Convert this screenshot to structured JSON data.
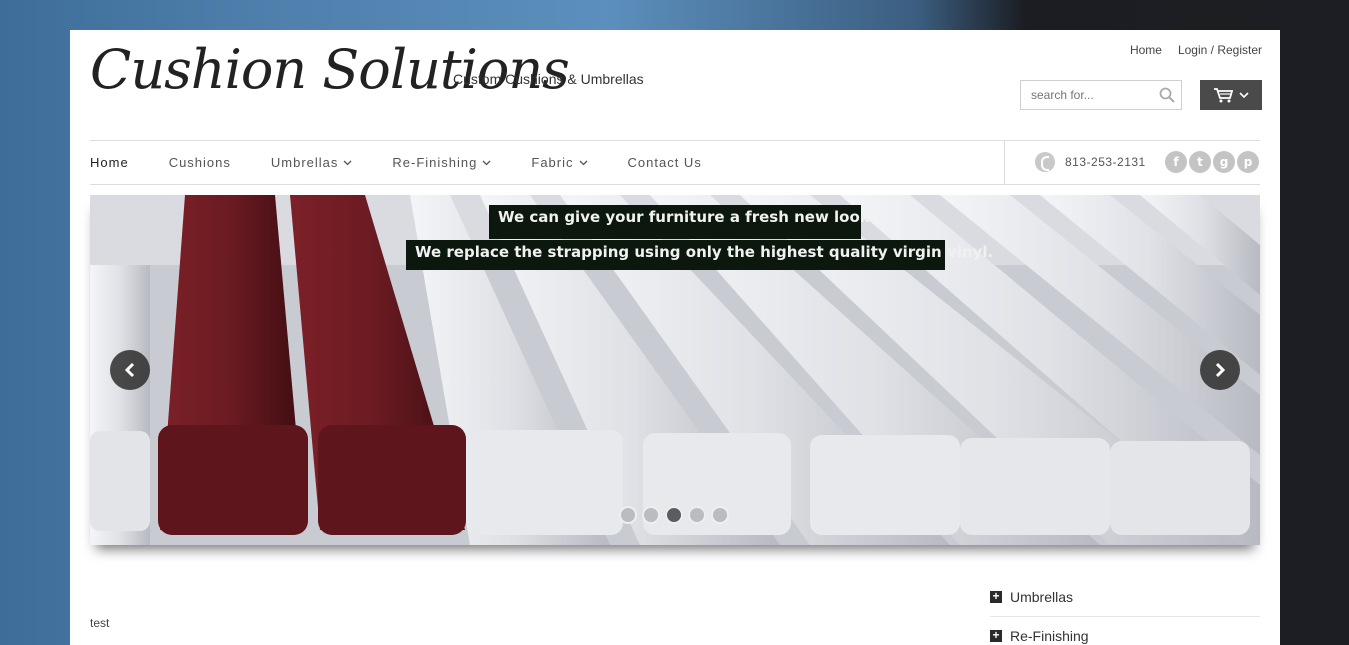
{
  "header": {
    "logo": "Cushion Solutions",
    "tagline": "Custom Cushions & Umbrellas",
    "links": [
      "Home",
      "Login / Register"
    ],
    "search_placeholder": "search for..."
  },
  "nav": {
    "items": [
      {
        "label": "Home",
        "dropdown": false,
        "active": true
      },
      {
        "label": "Cushions",
        "dropdown": false
      },
      {
        "label": "Umbrellas",
        "dropdown": true
      },
      {
        "label": "Re-Finishing",
        "dropdown": true
      },
      {
        "label": "Fabric",
        "dropdown": true
      },
      {
        "label": "Contact Us",
        "dropdown": false
      }
    ],
    "phone": "813-253-2131",
    "social": [
      "facebook-icon",
      "twitter-icon",
      "google-plus-icon",
      "pinterest-icon"
    ]
  },
  "slider": {
    "caption1": "We can give your furniture a fresh new look.",
    "caption2": "We replace the strapping using only the highest quality virgin vinyl.",
    "slide_count": 5,
    "active_slide": 3
  },
  "content": {
    "text": "test"
  },
  "sidebar": {
    "items": [
      "Umbrellas",
      "Re-Finishing"
    ]
  },
  "colors": {
    "caption_bg": "#0c180e",
    "cart_bg": "#4a4a4a",
    "strap_red": "#6a1c22"
  }
}
